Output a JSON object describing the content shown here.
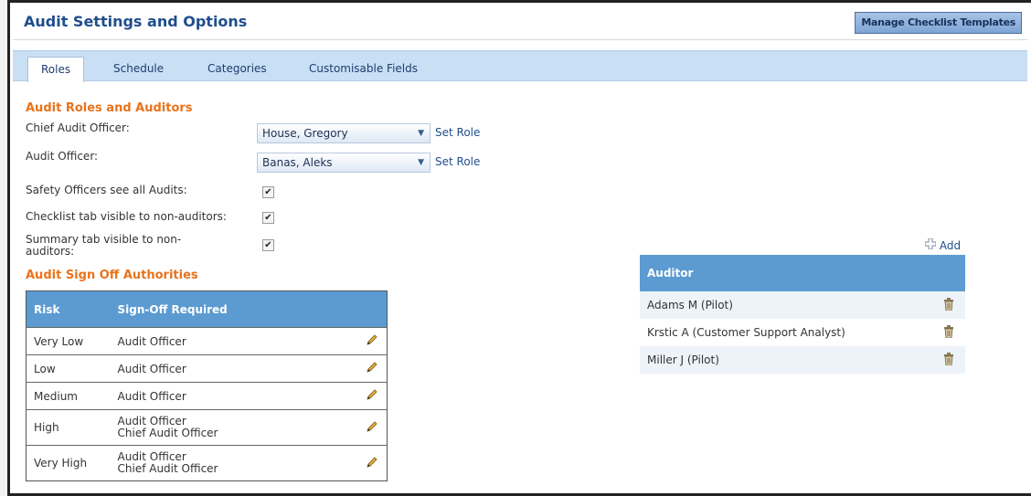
{
  "header": {
    "title": "Audit Settings and Options",
    "manage_button": "Manage Checklist Templates"
  },
  "tabs": [
    {
      "label": "Roles",
      "active": true
    },
    {
      "label": "Schedule",
      "active": false
    },
    {
      "label": "Categories",
      "active": false
    },
    {
      "label": "Customisable Fields",
      "active": false
    }
  ],
  "roles": {
    "section_title": "Audit Roles and Auditors",
    "chief_label": "Chief Audit Officer:",
    "chief_value": "House, Gregory",
    "officer_label": "Audit Officer:",
    "officer_value": "Banas, Aleks",
    "set_role": "Set Role",
    "safety_label": "Safety Officers see all Audits:",
    "checklist_label": "Checklist tab visible to non-auditors:",
    "summary_label_1": "Summary tab visible to non-",
    "summary_label_2": "auditors:",
    "check_glyph": "✔"
  },
  "signoff": {
    "section_title": "Audit Sign Off Authorities",
    "headers": {
      "risk": "Risk",
      "required": "Sign-Off Required"
    },
    "rows": [
      {
        "risk": "Very Low",
        "line1": "Audit Officer",
        "line2": ""
      },
      {
        "risk": "Low",
        "line1": "Audit Officer",
        "line2": ""
      },
      {
        "risk": "Medium",
        "line1": "Audit Officer",
        "line2": ""
      },
      {
        "risk": "High",
        "line1": "Audit Officer",
        "line2": "Chief Audit Officer"
      },
      {
        "risk": "Very High",
        "line1": "Audit Officer",
        "line2": "Chief Audit Officer"
      }
    ]
  },
  "auditors": {
    "add_label": "Add",
    "header": "Auditor",
    "rows": [
      "Adams M (Pilot)",
      "Krstic A (Customer Support Analyst)",
      "Miller J (Pilot)"
    ]
  },
  "colors": {
    "accent_orange": "#e8731c",
    "header_blue": "#5b9bd1",
    "title_blue": "#1f4e8c"
  }
}
